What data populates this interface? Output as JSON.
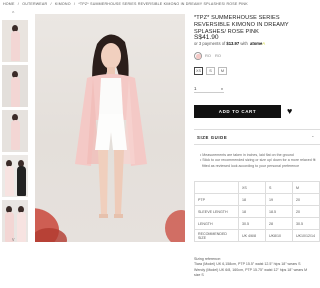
{
  "breadcrumb": [
    "HOME",
    "/",
    "OUTERWEAR",
    "/",
    "KIMONO",
    "/",
    "*TPZ* SUMMERHOUSE SERIES REVERSIBLE KIMONO IN DREAMY SPLASHES/ ROSE PINK"
  ],
  "gallery": {
    "up_arrow": "^",
    "down_arrow": "v"
  },
  "product": {
    "title": "*TPZ* SUMMERHOUSE SERIES REVERSIBLE KIMONO IN DREAMY SPLASHES/ ROSE PINK",
    "price": "S$41.90",
    "installment_prefix": "or 3 payments of",
    "installment_amount": "$13.97",
    "installment_suffix": "with",
    "installment_brand": "atome",
    "installment_brand_mark": "A",
    "color_labels": [
      "RO",
      "RO"
    ],
    "sizes": [
      "XS",
      "S",
      "M"
    ],
    "quantity": "1",
    "quantity_caret": "v",
    "add_to_cart": "ADD TO CART",
    "wishlist_icon": "heart-icon"
  },
  "size_guide": {
    "title": "SIZE GUIDE",
    "toggle": "-",
    "bullets": [
      "Measurements are taken in inches, laid flat on the ground",
      "Stick to our recommended sizing or size up/ down for a more relaxed fit",
      "fitted as reviewed look according to your personal preference"
    ],
    "table": [
      [
        "",
        "XS",
        "S",
        "M"
      ],
      [
        "PTP",
        "18",
        "19",
        "20"
      ],
      [
        "SLEEVE LENGTH",
        "18",
        "18.5",
        "20"
      ],
      [
        "LENGTH",
        "30.5",
        "28",
        "30.5"
      ],
      [
        "RECOMMENDED SIZE",
        "UK 4/6/8",
        "UK8/10",
        "UK10/12/14"
      ]
    ]
  },
  "fitting": {
    "heading": "Sizing reference:",
    "lines": [
      "Tiara (Model) UK 6,158cm, PTP 15.5\" waist 12.5\" hips 18\" wears S",
      "Wendy (Model) UK 6/8, 160cm, PTP 15.75\" waist 12\" hips 18\" wears M",
      "size S"
    ]
  },
  "colors": {
    "accent_dark": "#111111",
    "kimono_pink": "#f4c9c6",
    "atome_yellow": "#d3d93a"
  }
}
